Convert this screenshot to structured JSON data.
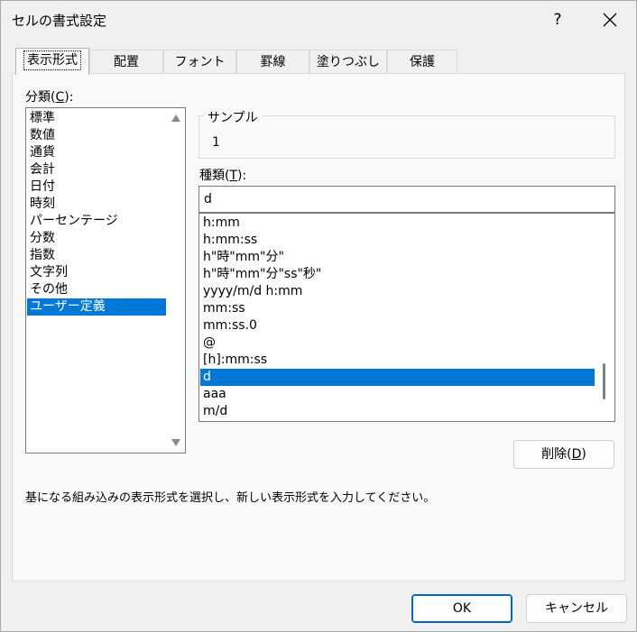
{
  "window": {
    "title": "セルの書式設定",
    "help_label": "?",
    "close_icon": "close-icon"
  },
  "tabs": [
    {
      "label": "表示形式",
      "active": true
    },
    {
      "label": "配置",
      "active": false
    },
    {
      "label": "フォント",
      "active": false
    },
    {
      "label": "罫線",
      "active": false
    },
    {
      "label": "塗りつぶし",
      "active": false
    },
    {
      "label": "保護",
      "active": false
    }
  ],
  "category": {
    "label": "分類(C):",
    "items": [
      "標準",
      "数値",
      "通貨",
      "会計",
      "日付",
      "時刻",
      "パーセンテージ",
      "分数",
      "指数",
      "文字列",
      "その他",
      "ユーザー定義"
    ],
    "selected": "ユーザー定義"
  },
  "sample": {
    "legend": "サンプル",
    "value": "1"
  },
  "type": {
    "label": "種類(T):",
    "value": "d",
    "items": [
      "h:mm",
      "h:mm:ss",
      "h\"時\"mm\"分\"",
      "h\"時\"mm\"分\"ss\"秒\"",
      "yyyy/m/d h:mm",
      "mm:ss",
      "mm:ss.0",
      "@",
      "[h]:mm:ss",
      "d",
      "aaa",
      "m/d"
    ],
    "selected": "d"
  },
  "buttons": {
    "delete": "削除(D)",
    "ok": "OK",
    "cancel": "キャンセル"
  },
  "description": "基になる組み込みの表示形式を選択し、新しい表示形式を入力してください。",
  "colors": {
    "selection": "#0078d7",
    "ok_border": "#0067c0"
  }
}
